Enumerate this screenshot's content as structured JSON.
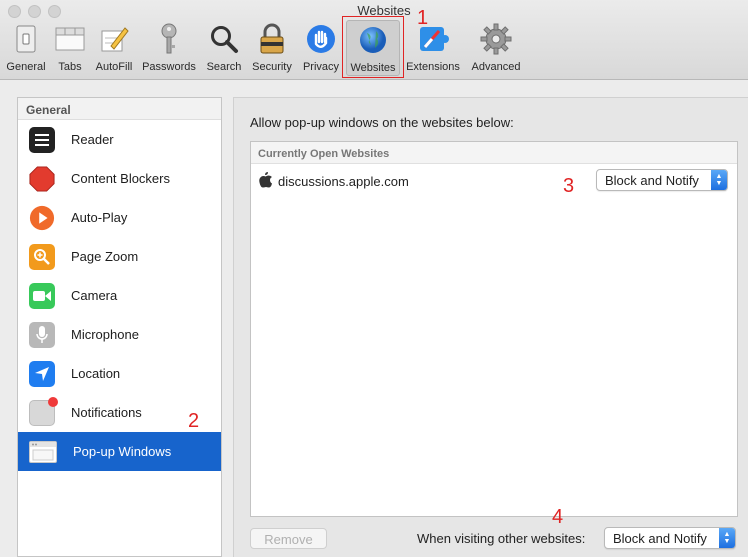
{
  "window": {
    "title": "Websites"
  },
  "toolbar": {
    "items": [
      {
        "label": "General",
        "icon": "general-switch-icon"
      },
      {
        "label": "Tabs",
        "icon": "tabs-icon"
      },
      {
        "label": "AutoFill",
        "icon": "autofill-pencil-icon"
      },
      {
        "label": "Passwords",
        "icon": "key-icon"
      },
      {
        "label": "Search",
        "icon": "magnifier-icon"
      },
      {
        "label": "Security",
        "icon": "padlock-icon"
      },
      {
        "label": "Privacy",
        "icon": "hand-icon"
      },
      {
        "label": "Websites",
        "icon": "globe-icon",
        "selected": true
      },
      {
        "label": "Extensions",
        "icon": "puzzle-compass-icon"
      },
      {
        "label": "Advanced",
        "icon": "gear-icon"
      }
    ]
  },
  "sidebar": {
    "header": "General",
    "items": [
      {
        "label": "Reader",
        "icon": "reader-icon"
      },
      {
        "label": "Content Blockers",
        "icon": "stop-sign-icon"
      },
      {
        "label": "Auto-Play",
        "icon": "play-icon"
      },
      {
        "label": "Page Zoom",
        "icon": "zoom-icon"
      },
      {
        "label": "Camera",
        "icon": "camera-icon"
      },
      {
        "label": "Microphone",
        "icon": "microphone-icon"
      },
      {
        "label": "Location",
        "icon": "location-arrow-icon"
      },
      {
        "label": "Notifications",
        "icon": "notifications-icon"
      },
      {
        "label": "Pop-up Windows",
        "icon": "popup-windows-icon",
        "selected": true
      }
    ]
  },
  "main": {
    "description": "Allow pop-up windows on the websites below:",
    "list_header": "Currently Open Websites",
    "rows": [
      {
        "site": "discussions.apple.com",
        "setting": "Block and Notify"
      }
    ],
    "remove_label": "Remove",
    "other_label": "When visiting other websites:",
    "other_setting": "Block and Notify"
  },
  "annotations": [
    "1",
    "2",
    "3",
    "4"
  ],
  "colors": {
    "accent": "#1764cc",
    "annotation": "#e02424"
  }
}
